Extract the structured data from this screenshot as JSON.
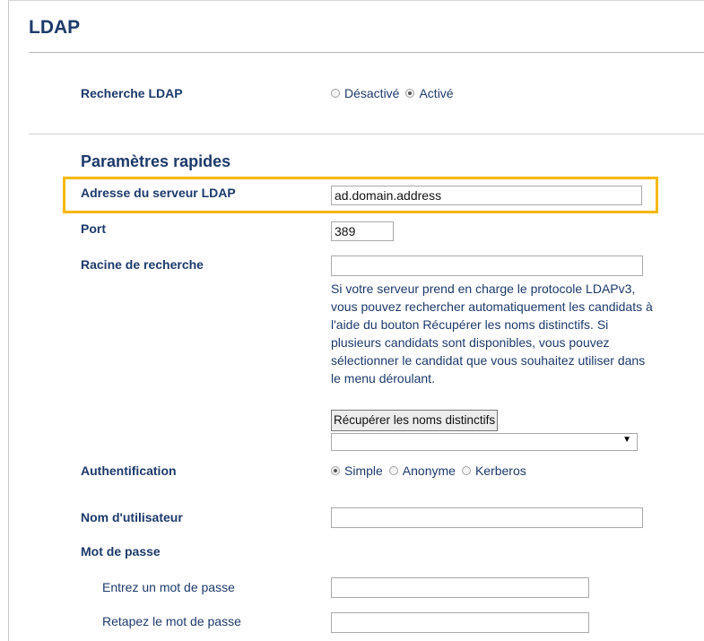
{
  "page": {
    "title": "LDAP"
  },
  "ldap_search": {
    "label": "Recherche LDAP",
    "options": [
      {
        "label": "Désactivé",
        "checked": false
      },
      {
        "label": "Activé",
        "checked": true
      }
    ]
  },
  "quick_settings": {
    "heading": "Paramètres rapides",
    "server_address": {
      "label": "Adresse du serveur LDAP",
      "value": "ad.domain.address"
    },
    "port": {
      "label": "Port",
      "value": "389"
    },
    "search_root": {
      "label": "Racine de recherche",
      "value": "",
      "help": "Si votre serveur prend en charge le protocole LDAPv3, vous pouvez rechercher automatiquement les candidats à l'aide du bouton Récupérer les noms distinctifs. Si plusieurs candidats sont disponibles, vous pouvez sélectionner le candidat que vous souhaitez utiliser dans le menu déroulant.",
      "fetch_button_label": "Récupérer les noms distinctifs",
      "dropdown_value": ""
    },
    "authentication": {
      "label": "Authentification",
      "options": [
        {
          "label": "Simple",
          "checked": true
        },
        {
          "label": "Anonyme",
          "checked": false
        },
        {
          "label": "Kerberos",
          "checked": false
        }
      ]
    },
    "username": {
      "label": "Nom d'utilisateur",
      "value": ""
    },
    "password": {
      "label": "Mot de passe",
      "enter_label": "Entrez un mot de passe",
      "enter_value": "",
      "retype_label": "Retapez le mot de passe",
      "retype_value": ""
    }
  },
  "colors": {
    "label_blue": "#1d3a6a",
    "highlight": "#f5b800"
  }
}
